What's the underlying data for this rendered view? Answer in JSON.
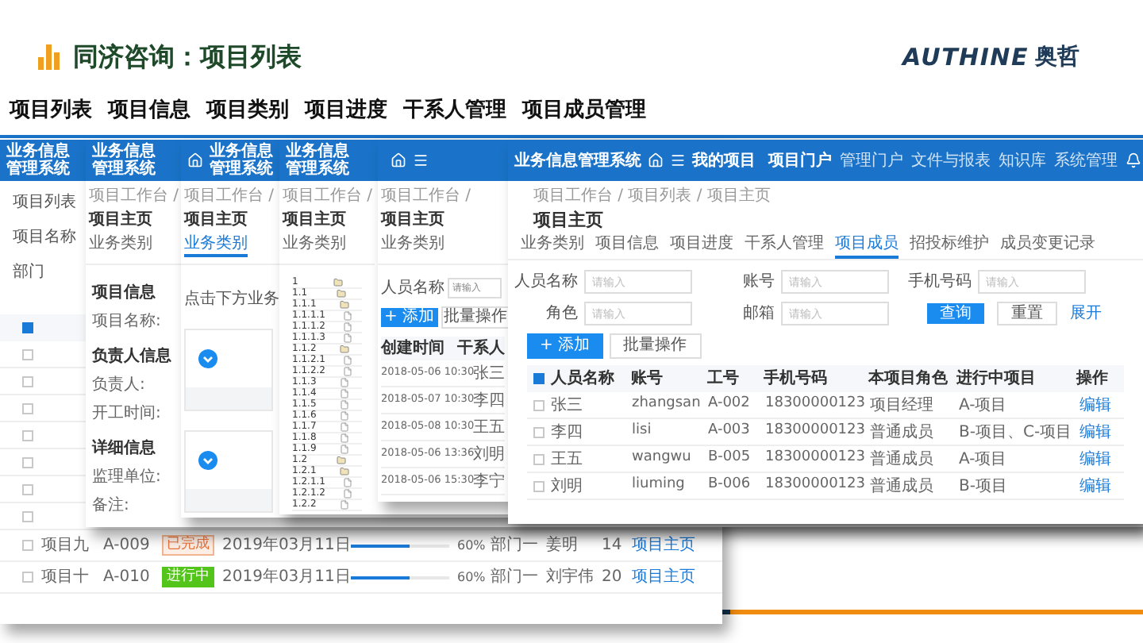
{
  "slide": {
    "title": "同济咨询：项目列表",
    "logo": "AUTHINE",
    "logo_cn": "奥哲"
  },
  "menu": [
    "项目列表",
    "项目信息",
    "项目类别",
    "项目进度",
    "干系人管理",
    "项目成员管理"
  ],
  "windows": [
    {
      "kind": "list",
      "app_title": "业务信息管理系统",
      "labels": [
        "项目列表",
        "项目名称",
        "部门"
      ],
      "rows": [
        {
          "kind": "header",
          "checked": true
        },
        {
          "kind": "covered",
          "checked": false
        },
        {
          "kind": "covered",
          "checked": false
        },
        {
          "kind": "covered",
          "checked": false
        },
        {
          "kind": "covered",
          "checked": false
        },
        {
          "kind": "covered",
          "checked": false
        },
        {
          "kind": "covered",
          "checked": false
        },
        {
          "kind": "covered",
          "checked": false
        },
        {
          "kind": "full",
          "checked": false,
          "name": "项目九",
          "code": "A-009",
          "status": {
            "label": "已完成",
            "kind": "done"
          },
          "date": "2019年03月11日",
          "level": 0.6,
          "reading": "60%",
          "dept": "部门一",
          "owner": "姜明",
          "count": "14",
          "link": "项目主页"
        },
        {
          "kind": "full",
          "checked": false,
          "name": "项目十",
          "code": "A-010",
          "status": {
            "label": "进行中",
            "kind": "active"
          },
          "date": "2019年03月11日",
          "level": 0.6,
          "reading": "60%",
          "dept": "部门一",
          "owner": "刘宇伟",
          "count": "20",
          "link": "项目主页"
        }
      ]
    },
    {
      "kind": "info",
      "app_title": "业务信息管理系统",
      "breadcrumb": "项目工作台 /",
      "page_title": "项目主页",
      "tabs": [
        {
          "label": "业务类别",
          "selected": false
        }
      ],
      "section": "项目信息",
      "fields": [
        {
          "kind": "field",
          "label": "项目名称:"
        },
        {
          "kind": "heading",
          "label": "负责人信息"
        },
        {
          "kind": "field",
          "label": "负责人:"
        },
        {
          "kind": "field",
          "label": "开工时间:"
        },
        {
          "kind": "heading",
          "label": "详细信息"
        },
        {
          "kind": "field",
          "label": "监理单位:"
        },
        {
          "kind": "field",
          "label": "备注:"
        }
      ]
    },
    {
      "kind": "category",
      "app_title": "业务信息管理系统",
      "breadcrumb": "项目工作台 /",
      "page_title": "项目主页",
      "tabs": [
        {
          "label": "业务类别",
          "selected": true
        }
      ],
      "prompt": "点击下方业务"
    },
    {
      "kind": "tree",
      "app_title": "业务信息管理系统",
      "breadcrumb": "项目工作台 /",
      "page_title": "项目主页",
      "tabs": [
        {
          "label": "业务类别",
          "selected": false
        }
      ],
      "tree": [
        {
          "number": "1",
          "kind": "folder",
          "children": [
            {
              "number": "1.1",
              "kind": "folder",
              "children": [
                {
                  "number": "1.1.1",
                  "kind": "folder",
                  "children": [
                    {
                      "number": "1.1.1.1",
                      "kind": "file"
                    },
                    {
                      "number": "1.1.1.2",
                      "kind": "file"
                    },
                    {
                      "number": "1.1.1.3",
                      "kind": "file"
                    }
                  ]
                },
                {
                  "number": "1.1.2",
                  "kind": "folder",
                  "children": [
                    {
                      "number": "1.1.2.1",
                      "kind": "file"
                    },
                    {
                      "number": "1.1.2.2",
                      "kind": "file"
                    }
                  ]
                },
                {
                  "number": "1.1.3",
                  "kind": "file"
                },
                {
                  "number": "1.1.4",
                  "kind": "file"
                },
                {
                  "number": "1.1.5",
                  "kind": "file"
                },
                {
                  "number": "1.1.6",
                  "kind": "file"
                },
                {
                  "number": "1.1.7",
                  "kind": "file"
                },
                {
                  "number": "1.1.8",
                  "kind": "file"
                },
                {
                  "number": "1.1.9",
                  "kind": "file"
                }
              ]
            },
            {
              "number": "1.2",
              "kind": "folder",
              "children": [
                {
                  "number": "1.2.1",
                  "kind": "folder",
                  "children": [
                    {
                      "number": "1.2.1.1",
                      "kind": "file"
                    },
                    {
                      "number": "1.2.1.2",
                      "kind": "file"
                    }
                  ]
                },
                {
                  "number": "1.2.2",
                  "kind": "file"
                }
              ]
            }
          ]
        }
      ]
    },
    {
      "kind": "people",
      "breadcrumb": "项目工作台 /",
      "page_title": "项目主页",
      "tabs": [
        {
          "label": "业务类别",
          "selected": false
        }
      ],
      "search_label": "人员名称",
      "search_placeholder": "请输入",
      "add": "+ 添加",
      "batch": "批量操作",
      "columns": [
        "创建时间",
        "干系人"
      ],
      "rows": [
        [
          "2018-05-06 10:30",
          "张三"
        ],
        [
          "2018-05-07 10:30",
          "李四"
        ],
        [
          "2018-05-08 10:30",
          "王五"
        ],
        [
          "2018-05-06 13:36",
          "刘明"
        ],
        [
          "2018-05-06 15:30",
          "李宁"
        ]
      ]
    },
    {
      "kind": "members",
      "app_title": "业务信息管理系统",
      "nav_title": "我的项目",
      "nav": [
        {
          "label": "项目门户",
          "selected": true
        },
        {
          "label": "管理门户",
          "selected": false
        },
        {
          "label": "文件与报表",
          "selected": false
        },
        {
          "label": "知识库",
          "selected": false
        },
        {
          "label": "系统管理",
          "selected": false
        }
      ],
      "breadcrumb": "项目工作台 / 项目列表 / 项目主页",
      "page_title": "项目主页",
      "tabs": [
        {
          "label": "业务类别",
          "selected": false
        },
        {
          "label": "项目信息",
          "selected": false
        },
        {
          "label": "项目进度",
          "selected": false
        },
        {
          "label": "干系人管理",
          "selected": false
        },
        {
          "label": "项目成员",
          "selected": true
        },
        {
          "label": "招投标维护",
          "selected": false
        },
        {
          "label": "成员变更记录",
          "selected": false
        }
      ],
      "filters": [
        {
          "label": "人员名称",
          "placeholder": "请输入"
        },
        {
          "label": "账号",
          "placeholder": "请输入"
        },
        {
          "label": "手机号码",
          "placeholder": "请输入"
        },
        {
          "label": "角色",
          "placeholder": "请输入"
        },
        {
          "label": "邮箱",
          "placeholder": "请输入"
        }
      ],
      "query": "查询",
      "reset": "重置",
      "expand": "展开",
      "add": "+ 添加",
      "batch": "批量操作",
      "columns": [
        "人员名称",
        "账号",
        "工号",
        "手机号码",
        "本项目角色",
        "进行中项目",
        "操作"
      ],
      "all_checked": true,
      "rows": [
        {
          "checked": false,
          "cells": [
            "张三",
            "zhangsan",
            "A-002",
            "18300000123",
            "项目经理",
            "A-项目"
          ],
          "action": "编辑"
        },
        {
          "checked": false,
          "cells": [
            "李四",
            "lisi",
            "A-003",
            "18300000123",
            "普通成员",
            "B-项目、C-项目"
          ],
          "action": "编辑"
        },
        {
          "checked": false,
          "cells": [
            "王五",
            "wangwu",
            "B-005",
            "18300000123",
            "普通成员",
            "A-项目"
          ],
          "action": "编辑"
        },
        {
          "checked": false,
          "cells": [
            "刘明",
            "liuming",
            "B-006",
            "18300000123",
            "普通成员",
            "B-项目"
          ],
          "action": "编辑"
        }
      ]
    }
  ]
}
